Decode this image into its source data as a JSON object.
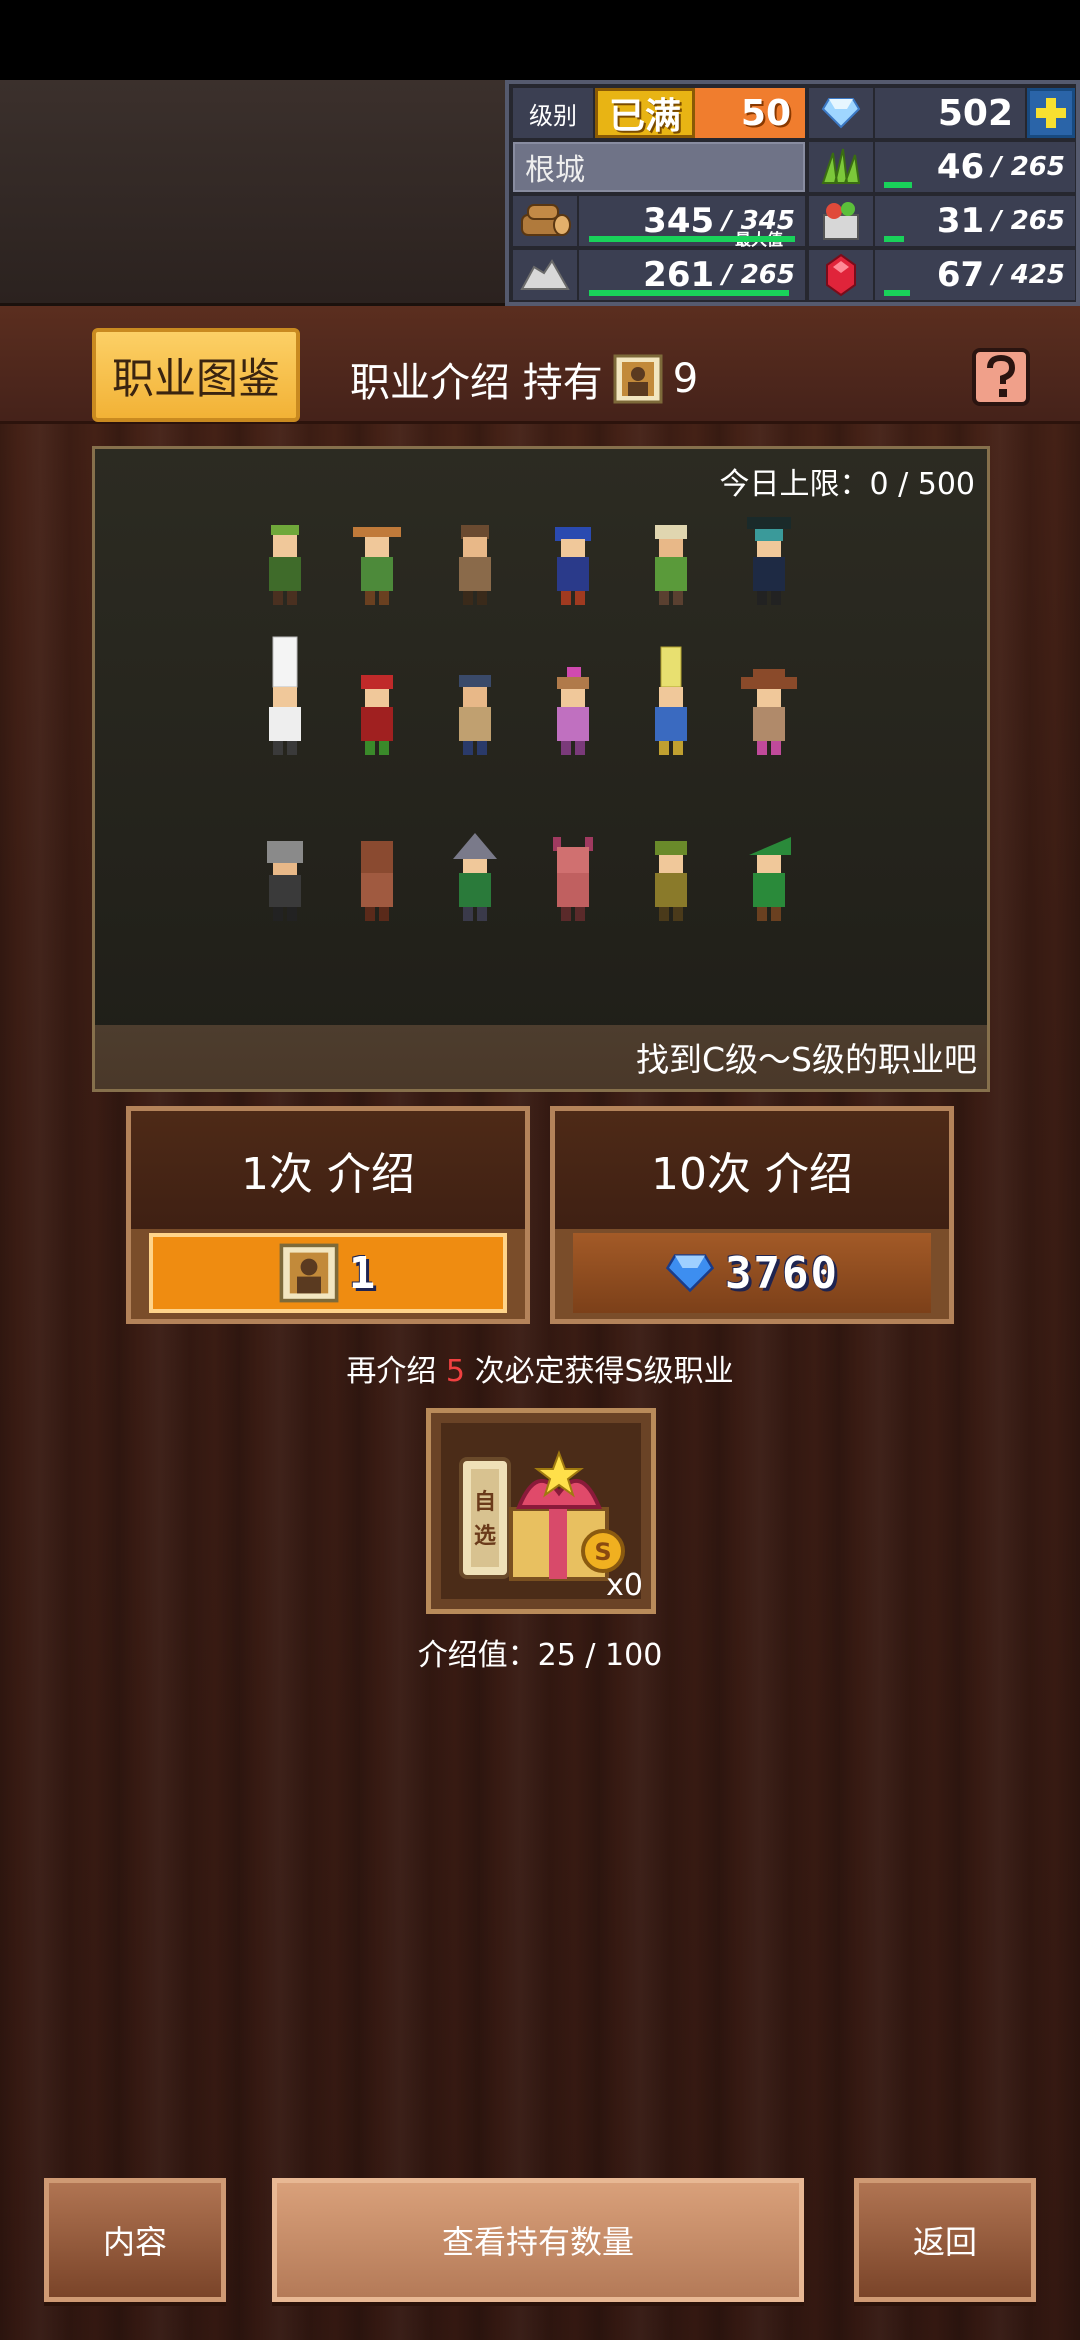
{
  "hud": {
    "level_label": "级别",
    "level_status": "已满",
    "level_value": "50",
    "gems": "502",
    "town_name": "根城",
    "wood": {
      "current": "345",
      "max": "345",
      "max_tag": "最大值",
      "fill": 1.0
    },
    "stone": {
      "current": "261",
      "max": "265",
      "fill": 0.98
    },
    "herb": {
      "current": "46",
      "max": "265",
      "fill": 0.17
    },
    "food": {
      "current": "31",
      "max": "265",
      "fill": 0.12
    },
    "ruby": {
      "current": "67",
      "max": "425",
      "fill": 0.16
    },
    "icons": [
      "gem-icon",
      "plus-icon",
      "herb-icon",
      "wood-icon",
      "food-icon",
      "stone-icon",
      "ruby-icon"
    ]
  },
  "header": {
    "tab_label": "职业图鉴",
    "title": "职业介绍 持有",
    "ticket_count": "9",
    "help_icon": "question-icon"
  },
  "gallery": {
    "daily_limit": "今日上限：0 / 500",
    "footer_text": "找到C级～S级的职业吧"
  },
  "intro": {
    "single_label": "1次 介绍",
    "single_cost": "1",
    "ten_label": "10次 介绍",
    "ten_cost": "3760"
  },
  "guarantee": {
    "prefix": "再介绍",
    "count": "5",
    "suffix": "次必定获得S级职业"
  },
  "reward": {
    "box_text": "自选",
    "count": "x0",
    "intro_value": "介绍值：25 / 100"
  },
  "buttons": {
    "content": "内容",
    "view_holdings": "查看持有数量",
    "back": "返回"
  },
  "colors": {
    "accent_tab": "#f2b236",
    "cost_orange": "#ef8c11",
    "progress_green": "#19d25a",
    "guarantee_red": "#f04040"
  }
}
